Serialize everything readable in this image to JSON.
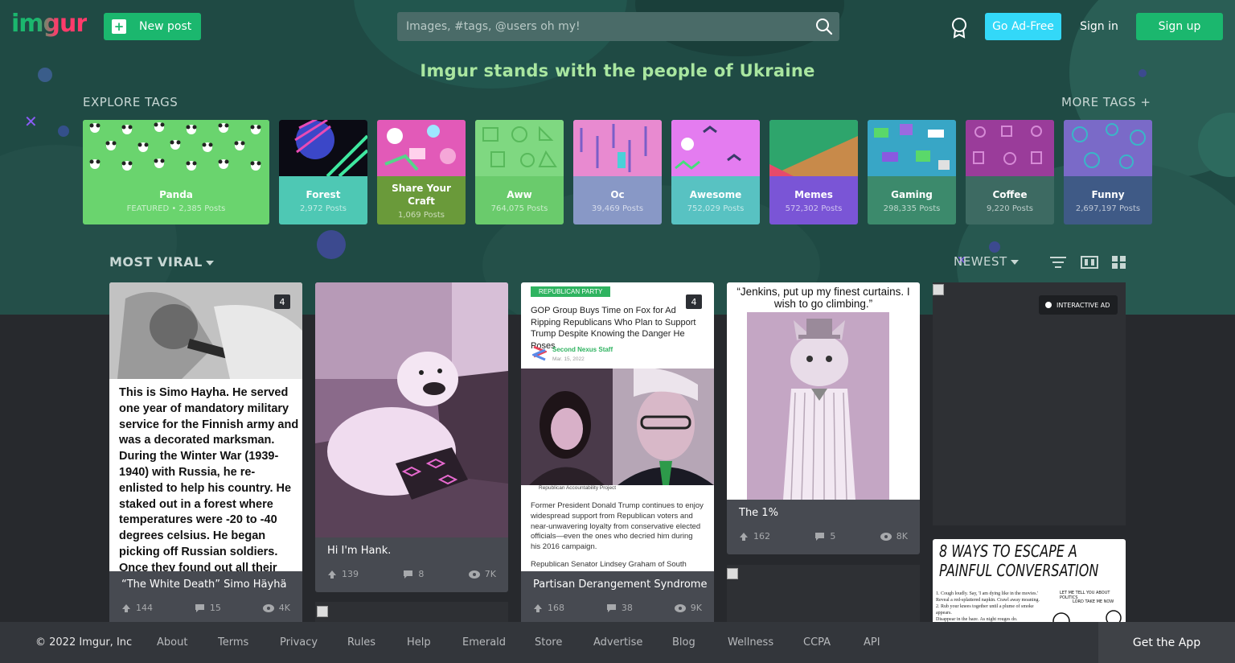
{
  "header": {
    "logo_text": "imgur",
    "new_post_label": "New post",
    "search_placeholder": "Images, #tags, @users oh my!",
    "ad_free_label": "Go Ad-Free",
    "sign_in_label": "Sign in",
    "sign_up_label": "Sign up"
  },
  "banner": "Imgur stands with the people of Ukraine",
  "explore": {
    "label": "EXPLORE TAGS",
    "more_label": "MORE TAGS +",
    "tags": [
      {
        "name": "Panda",
        "count": "FEATURED • 2,385 Posts"
      },
      {
        "name": "Forest",
        "count": "2,972 Posts"
      },
      {
        "name": "Share Your Craft",
        "count": "1,069 Posts"
      },
      {
        "name": "Aww",
        "count": "764,075 Posts"
      },
      {
        "name": "Oc",
        "count": "39,469 Posts"
      },
      {
        "name": "Awesome",
        "count": "752,029 Posts"
      },
      {
        "name": "Memes",
        "count": "572,302 Posts"
      },
      {
        "name": "Gaming",
        "count": "298,335 Posts"
      },
      {
        "name": "Coffee",
        "count": "9,220 Posts"
      },
      {
        "name": "Funny",
        "count": "2,697,197 Posts"
      }
    ]
  },
  "feed": {
    "section_label": "MOST VIRAL",
    "sort_label": "NEWEST",
    "posts": [
      {
        "title": "“The White Death” Simo Häyhä",
        "badge": "4",
        "upvotes": "144",
        "comments": "15",
        "views": "4K",
        "image_text": "This is Simo Hayha. He served one year of mandatory military service for the Finnish army and was a decorated marksman. During the Winter War (1939-1940) with Russia, he re-enlisted to help his country. He staked out in a forest where temperatures were -20 to -40 degrees celsius. He began picking off Russian soldiers. Once they found out all their"
      },
      {
        "title": "Hi I'm Hank.",
        "upvotes": "139",
        "comments": "8",
        "views": "7K"
      },
      {
        "title": "Partisan Derangement Syndrome",
        "badge": "4",
        "upvotes": "168",
        "comments": "38",
        "views": "9K",
        "article_tag": "REPUBLICAN PARTY",
        "article_headline": "GOP Group Buys Time on Fox for Ad Ripping Republicans Who Plan to Support Trump Despite Knowing the Danger He Poses",
        "article_author": "Second Nexus Staff",
        "article_date": "Mar. 15, 2022",
        "article_caption": "Republican Accountability Project",
        "article_body": "Former President Donald Trump continues to enjoy widespread support from Republican voters and near-unwavering loyalty from conservative elected officials—even the ones who decried him during his 2016 campaign.",
        "article_body2": "Republican Senator Lindsey Graham of South"
      },
      {
        "title": "The 1%",
        "upvotes": "162",
        "comments": "5",
        "views": "8K",
        "caption": "“Jenkins, put up my finest curtains. I wish to go climbing.”"
      }
    ],
    "ad_label": "INTERACTIVE AD",
    "comic_title": "8 WAYS TO ESCAPE A PAINFUL CONVERSATION",
    "comic_lines": [
      "1. Cough loudly. Say, 'I am dying like in the movies.'",
      "Reveal a red-splattered napkin. Crawl away moaning.",
      "2. Rub your knees together until a plume of smoke appears.",
      "Disappear in the haze. As night rouges do."
    ],
    "comic_speech1": "LET ME TELL YOU ABOUT POLITICS",
    "comic_speech2": "LORD TAKE ME NOW"
  },
  "footer": {
    "copyright": "© 2022 Imgur, Inc",
    "links": [
      "About",
      "Terms",
      "Privacy",
      "Rules",
      "Help",
      "Emerald",
      "Store",
      "Advertise",
      "Blog",
      "Wellness",
      "CCPA",
      "API"
    ],
    "get_app_label": "Get the App"
  },
  "colors": {
    "hero_bg": "#1f4a44",
    "accent_green": "#1bb76e",
    "ad_free_blue": "#33d8f8",
    "banner_text": "#a9e6a0",
    "card_bg": "#474a51"
  },
  "icons": {
    "search": "search-icon",
    "medal": "medal-icon",
    "upvote": "arrow-up-icon",
    "comment": "comment-icon",
    "views": "eye-icon",
    "filter": "filter-lines-icon",
    "layout_list": "layout-waterfall-icon",
    "layout_grid": "layout-grid-icon"
  }
}
